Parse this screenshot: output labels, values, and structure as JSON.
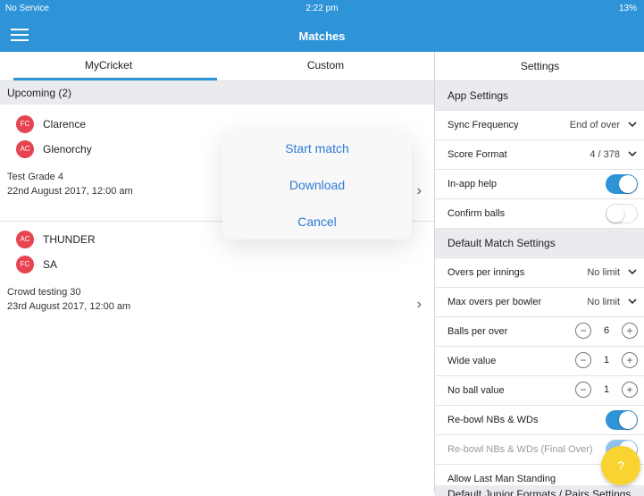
{
  "status": {
    "carrier": "No Service",
    "time": "2:22 pm",
    "battery": "13%"
  },
  "nav": {
    "title": "Matches"
  },
  "tabs": [
    {
      "label": "MyCricket"
    },
    {
      "label": "Custom"
    }
  ],
  "upcoming": {
    "label": "Upcoming (2)"
  },
  "matches": [
    {
      "team1": {
        "badge": "FC",
        "name": "Clarence"
      },
      "team2": {
        "badge": "AC",
        "name": "Glenorchy"
      },
      "grade": "Test Grade 4",
      "date": "22nd August 2017, 12:00 am"
    },
    {
      "team1": {
        "badge": "AC",
        "name": "THUNDER"
      },
      "team2": {
        "badge": "FC",
        "name": "SA"
      },
      "grade": "Crowd testing 30",
      "date": "23rd August 2017, 12:00 am"
    }
  ],
  "popup": {
    "options": [
      "Start match",
      "Download",
      "Cancel"
    ]
  },
  "settings": {
    "title": "Settings",
    "app_header": "App Settings",
    "sync_frequency": {
      "label": "Sync Frequency",
      "value": "End of over"
    },
    "score_format": {
      "label": "Score Format",
      "value": "4 / 378"
    },
    "in_app_help": {
      "label": "In-app help",
      "on": true
    },
    "confirm_balls": {
      "label": "Confirm balls",
      "on": false
    },
    "match_header": "Default Match Settings",
    "overs_per_innings": {
      "label": "Overs per innings",
      "value": "No limit"
    },
    "max_overs_per_bowler": {
      "label": "Max overs per bowler",
      "value": "No limit"
    },
    "balls_per_over": {
      "label": "Balls per over",
      "value": "6"
    },
    "wide_value": {
      "label": "Wide value",
      "value": "1"
    },
    "no_ball_value": {
      "label": "No ball value",
      "value": "1"
    },
    "rebowl": {
      "label": "Re-bowl NBs & WDs",
      "on": true
    },
    "rebowl_final": {
      "label": "Re-bowl NBs & WDs (Final Over)",
      "on": true
    },
    "last_man": {
      "label": "Allow Last Man Standing"
    },
    "junior_header": "Default Junior Formats / Pairs Settings"
  },
  "help_button": {
    "label": "?"
  },
  "colors": {
    "accent": "#2f93d8",
    "badge": "#e64450",
    "help": "#f9d32f"
  },
  "icons": {
    "menu": "hamburger-icon",
    "chevron": "chevron-right-icon",
    "dropdown": "chevron-down-icon"
  }
}
